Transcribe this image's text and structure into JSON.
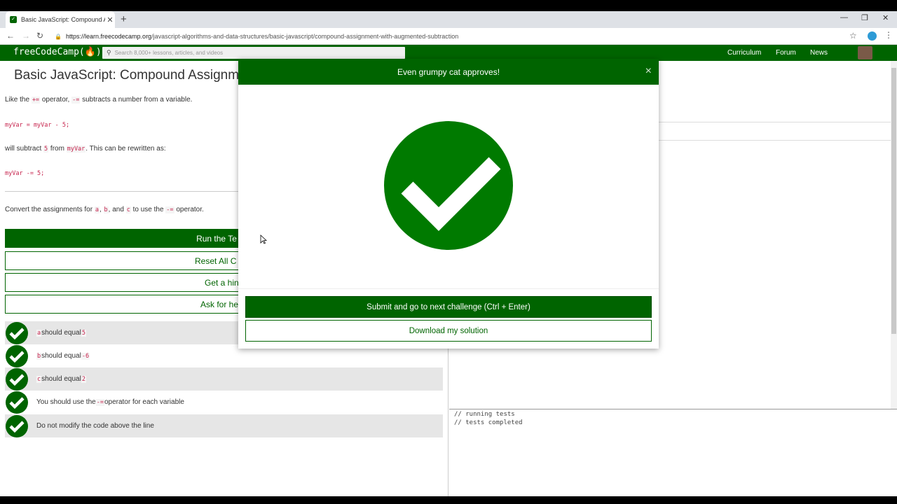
{
  "browser": {
    "tab_title": "Basic JavaScript: Compound Assi",
    "url_host": "https://learn.freecodecamp.org",
    "url_path": "/javascript-algorithms-and-data-structures/basic-javascript/compound-assignment-with-augmented-subtraction"
  },
  "nav": {
    "logo": "freeCodeCamp(🔥)",
    "search_placeholder": "Search 8,000+ lessons, articles, and videos",
    "links": [
      "Curriculum",
      "Forum",
      "News"
    ]
  },
  "lesson": {
    "title": "Basic JavaScript: Compound Assignme",
    "p1_a": "Like the ",
    "p1_code1": "+=",
    "p1_b": " operator, ",
    "p1_code2": "-=",
    "p1_c": " subtracts a number from a variable.",
    "code1": "myVar = myVar - 5;",
    "p2_a": "will subtract ",
    "p2_code1": "5",
    "p2_b": " from ",
    "p2_code2": "myVar",
    "p2_c": ". This can be rewritten as:",
    "code2": "myVar -= 5;",
    "p3_a": "Convert the assignments for ",
    "p3_code1": "a",
    "p3_b": ", ",
    "p3_code2": "b",
    "p3_c": ", and ",
    "p3_code3": "c",
    "p3_d": " to use the ",
    "p3_code4": "-=",
    "p3_e": " operator."
  },
  "buttons": {
    "run": "Run the Te",
    "reset": "Reset All C",
    "hint": "Get a hin",
    "ask": "Ask for he"
  },
  "tests": [
    {
      "code": "a",
      "text": " should equal ",
      "val": "5"
    },
    {
      "code": "b",
      "text": " should equal ",
      "val": "-6"
    },
    {
      "code": "c",
      "text": " should equal ",
      "val": "2"
    },
    {
      "pre": "You should use the ",
      "code": "-=",
      "text": " operator for each variable"
    },
    {
      "text": "Do not modify the code above the line"
    }
  ],
  "console": {
    "line1": "// running tests",
    "line2": "// tests completed"
  },
  "modal": {
    "title": "Even grumpy cat approves!",
    "close": "×",
    "submit": "Submit and go to next challenge (Ctrl + Enter)",
    "download": "Download my solution"
  },
  "colors": {
    "brand": "#006400"
  }
}
